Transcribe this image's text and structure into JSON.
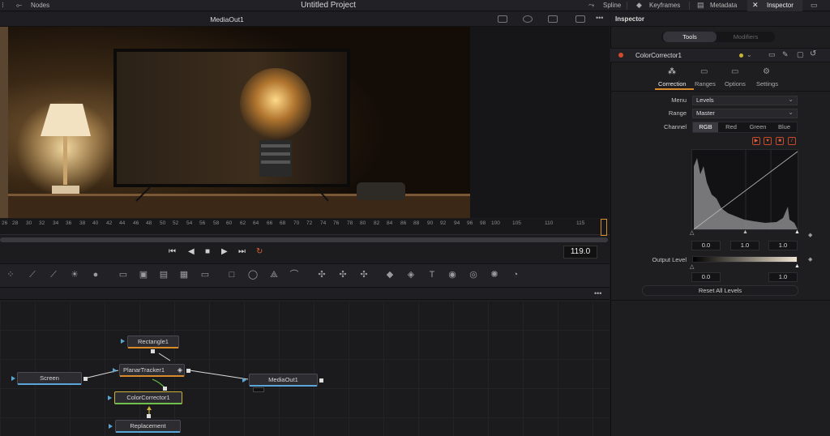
{
  "app": {
    "project_title": "Untitled Project"
  },
  "topbar": {
    "nodes_label": "Nodes",
    "spline_label": "Spline",
    "keyframes_label": "Keyframes",
    "metadata_label": "Metadata",
    "inspector_label": "Inspector"
  },
  "viewer": {
    "title": "MediaOut1"
  },
  "timeline": {
    "ticks": [
      "26",
      "28",
      "30",
      "32",
      "34",
      "36",
      "38",
      "40",
      "42",
      "44",
      "46",
      "48",
      "50",
      "52",
      "54",
      "56",
      "58",
      "60",
      "62",
      "64",
      "66",
      "68",
      "70",
      "72",
      "74",
      "76",
      "78",
      "80",
      "82",
      "84",
      "86",
      "88",
      "90",
      "92",
      "94",
      "96",
      "98",
      "100",
      "105",
      "110",
      "115"
    ],
    "current_frame": "119.0"
  },
  "nodes": [
    {
      "id": "rectangle",
      "label": "Rectangle1"
    },
    {
      "id": "screen",
      "label": "Screen"
    },
    {
      "id": "planartracker",
      "label": "PlanarTracker1"
    },
    {
      "id": "mediaout",
      "label": "MediaOut1"
    },
    {
      "id": "colorcorrector",
      "label": "ColorCorrector1"
    },
    {
      "id": "replacement",
      "label": "Replacement"
    }
  ],
  "inspector": {
    "title": "Inspector",
    "top_tabs": [
      "Tools",
      "Modifiers"
    ],
    "tool_name": "ColorCorrector1",
    "sub_tabs": [
      "Correction",
      "Ranges",
      "Options",
      "Settings"
    ],
    "menu_label": "Menu",
    "menu_value": "Levels",
    "range_label": "Range",
    "range_value": "Master",
    "channel_label": "Channel",
    "channels": [
      "RGB",
      "Red",
      "Green",
      "Blue"
    ],
    "input_levels": [
      "0.0",
      "1.0",
      "1.0"
    ],
    "output_label": "Output Level",
    "output_levels": [
      "0.0",
      "1.0"
    ],
    "reset_label": "Reset All Levels"
  },
  "colors": {
    "accent_orange": "#d98a2a",
    "selected_tab_bg": "#3a3a40",
    "node_yellow": "#c9b23a",
    "link_blue": "#5aa6d8"
  }
}
